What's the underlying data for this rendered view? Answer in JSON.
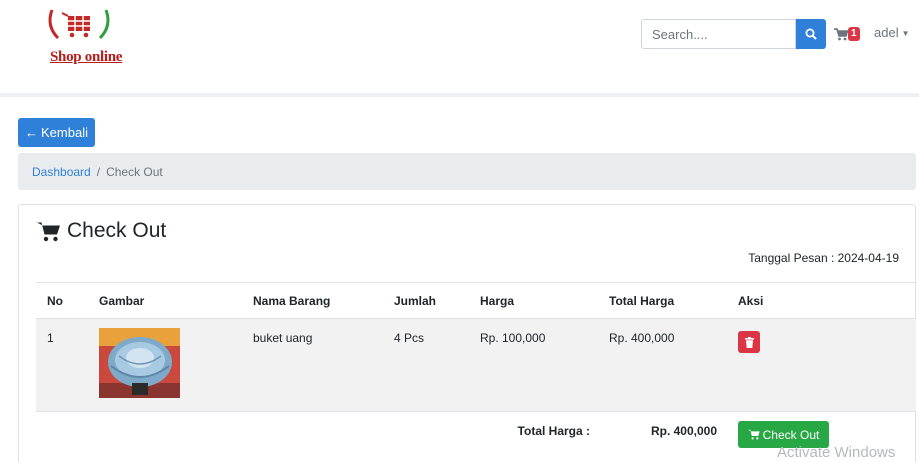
{
  "brand": {
    "logo_text": "Shop online",
    "accent_color": "#b71c1c",
    "icon": "cart-logo-icon"
  },
  "header": {
    "search_placeholder": "Search....",
    "search_icon": "search-icon",
    "cart_icon": "cart-icon",
    "cart_count": "1",
    "user_name": "adel",
    "user_caret": "▼"
  },
  "back_button": {
    "icon": "←",
    "label": "Kembali"
  },
  "breadcrumb": {
    "home": "Dashboard",
    "separator": "/",
    "current": "Check Out"
  },
  "checkout": {
    "title": "Check Out",
    "order_date_label": "Tanggal Pesan : 2024-04-19",
    "columns": [
      "No",
      "Gambar",
      "Nama Barang",
      "Jumlah",
      "Harga",
      "Total Harga",
      "Aksi"
    ],
    "items": [
      {
        "no": "1",
        "image": "bouquet-image",
        "name": "buket uang",
        "qty": "4 Pcs",
        "price": "Rp. 100,000",
        "total": "Rp. 400,000",
        "action_icon": "trash-icon"
      }
    ],
    "total_label": "Total Harga :",
    "total_value": "Rp. 400,000",
    "checkout_button": "Check Out"
  },
  "watermark": "Activate Windows",
  "colors": {
    "primary": "#2f80d8",
    "danger": "#dc3545",
    "success": "#28a745"
  }
}
